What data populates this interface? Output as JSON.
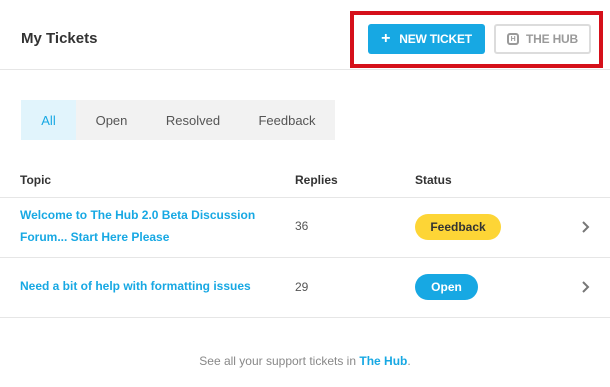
{
  "header": {
    "title": "My Tickets",
    "new_ticket_label": "NEW TICKET",
    "new_ticket_icon": "plus-icon",
    "hub_label": "THE HUB",
    "hub_icon": "hub-logo-icon",
    "hub_icon_glyph": "H"
  },
  "tabs": [
    {
      "label": "All",
      "active": true
    },
    {
      "label": "Open",
      "active": false
    },
    {
      "label": "Resolved",
      "active": false
    },
    {
      "label": "Feedback",
      "active": false
    }
  ],
  "table": {
    "columns": [
      "Topic",
      "Replies",
      "Status"
    ],
    "rows": [
      {
        "topic_line1": "Welcome to The Hub 2.0 Beta Discussion",
        "topic_line2": "Forum... Start Here Please",
        "replies": "36",
        "status": "Feedback",
        "status_color": "#fdd536"
      },
      {
        "topic_line1": "Need a bit of help with formatting issues",
        "replies": "29",
        "status": "Open",
        "status_color": "#17a8e3"
      }
    ]
  },
  "footer": {
    "text": "See all your support tickets in ",
    "link": "The Hub",
    "suffix": "."
  },
  "colors": {
    "accent": "#17a8e3",
    "highlight": "#d5101a",
    "feedback": "#fdd536"
  }
}
